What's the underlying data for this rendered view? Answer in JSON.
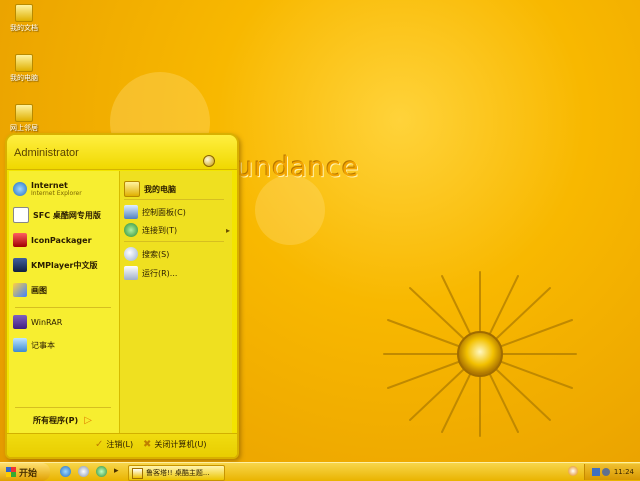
{
  "desktop": {
    "brand_text": "undance",
    "icons": [
      {
        "label": "我的文档"
      },
      {
        "label": "我的电脑"
      },
      {
        "label": "网上邻居"
      }
    ]
  },
  "start_menu": {
    "user_name": "Administrator",
    "left": {
      "internet": {
        "title": "Internet",
        "subtitle": "Internet Explorer"
      },
      "sfc": "SFC 桌酷网专用版",
      "iconpackager": "IconPackager",
      "kmplayer": "KMPlayer中文版",
      "paint": "画图",
      "winrar": "WinRAR",
      "notepad": "记事本",
      "all_programs": "所有程序(P)"
    },
    "right": {
      "my_computer": "我的电脑",
      "control_panel": "控制面板(C)",
      "connect_to": "连接到(T)",
      "search": "搜索(S)",
      "run": "运行(R)..."
    },
    "footer": {
      "logoff": "注销(L)",
      "shutdown": "关闭计算机(U)"
    }
  },
  "taskbar": {
    "start_label": "开始",
    "task_button": "鲁客塔!! 桌酷主题...",
    "clock": "11:24"
  },
  "colors": {
    "desktop_bg": "#f8b800",
    "menu_bg": "#f3e400",
    "taskbar_bg": "#e9b300"
  }
}
